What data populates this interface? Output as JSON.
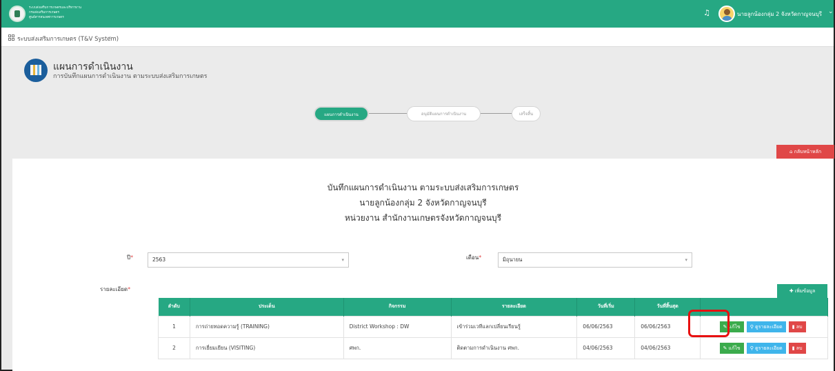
{
  "header": {
    "org_lines": [
      "ระบบส่งเสริมการเกษตรและบริหารงาน",
      "กรมส่งเสริมการเกษตร",
      "ศูนย์สารสนเทศการเกษตร"
    ],
    "bell_icon": "bell-icon",
    "user_name": "นายลูกน้องกลุ่ม 2 จังหวัดกาญจนบุรี",
    "caret": "⌄"
  },
  "system_bar": {
    "label": "ระบบส่งเสริมการเกษตร (T&V System)",
    "caret": "⌄"
  },
  "page": {
    "title": "แผนการดำเนินงาน",
    "subtitle": "การบันทึกแผนการดำเนินงาน ตามระบบส่งเสริมการเกษตร"
  },
  "steps": [
    {
      "label": "แผนการดำเนินงาน",
      "state": "active"
    },
    {
      "label": "อนุมัติแผนการดำเนินงาน",
      "state": "pending"
    },
    {
      "label": "เสร็จสิ้น",
      "state": "pending"
    }
  ],
  "home_button": "กลับหน้าหลัก",
  "form": {
    "heading_line1": "บันทึกแผนการดำเนินงาน ตามระบบส่งเสริมการเกษตร",
    "heading_line2": "นายลูกน้องกลุ่ม 2 จังหวัดกาญจนบุรี",
    "heading_line3": "หน่วยงาน สำนักงานเกษตรจังหวัดกาญจนบุรี",
    "year_label": "ปี",
    "year_value": "2563",
    "month_label": "เดือน",
    "month_value": "มิถุนายน",
    "details_label": "รายละเอียด",
    "required_mark": "*",
    "add_button": "เพิ่มข้อมูล"
  },
  "table": {
    "columns": [
      "ลำดับ",
      "ประเด็น",
      "กิจกรรม",
      "รายละเอียด",
      "วันที่เริ่ม",
      "วันที่สิ้นสุด",
      ""
    ],
    "rows": [
      {
        "no": "1",
        "topic": "การถ่ายทอดความรู้ (TRAINING)",
        "activity": "District Workshop : DW",
        "detail": "เข้าร่วมเวทีแลกเปลี่ยนเรียนรู้",
        "start": "06/06/2563",
        "end": "06/06/2563"
      },
      {
        "no": "2",
        "topic": "การเยี่ยมเยียน (VISITING)",
        "activity": "ศพก.",
        "detail": "ติดตามการดำเนินงาน ศพก.",
        "start": "04/06/2563",
        "end": "04/06/2563"
      }
    ],
    "actions": {
      "edit": "แก้ไข",
      "detail": "ดูรายละเอียด",
      "delete": "ลบ"
    }
  },
  "colors": {
    "primary": "#26a883",
    "danger": "#e04747",
    "info": "#3fb5eb",
    "success": "#3bab4c",
    "highlight": "#e81010"
  }
}
